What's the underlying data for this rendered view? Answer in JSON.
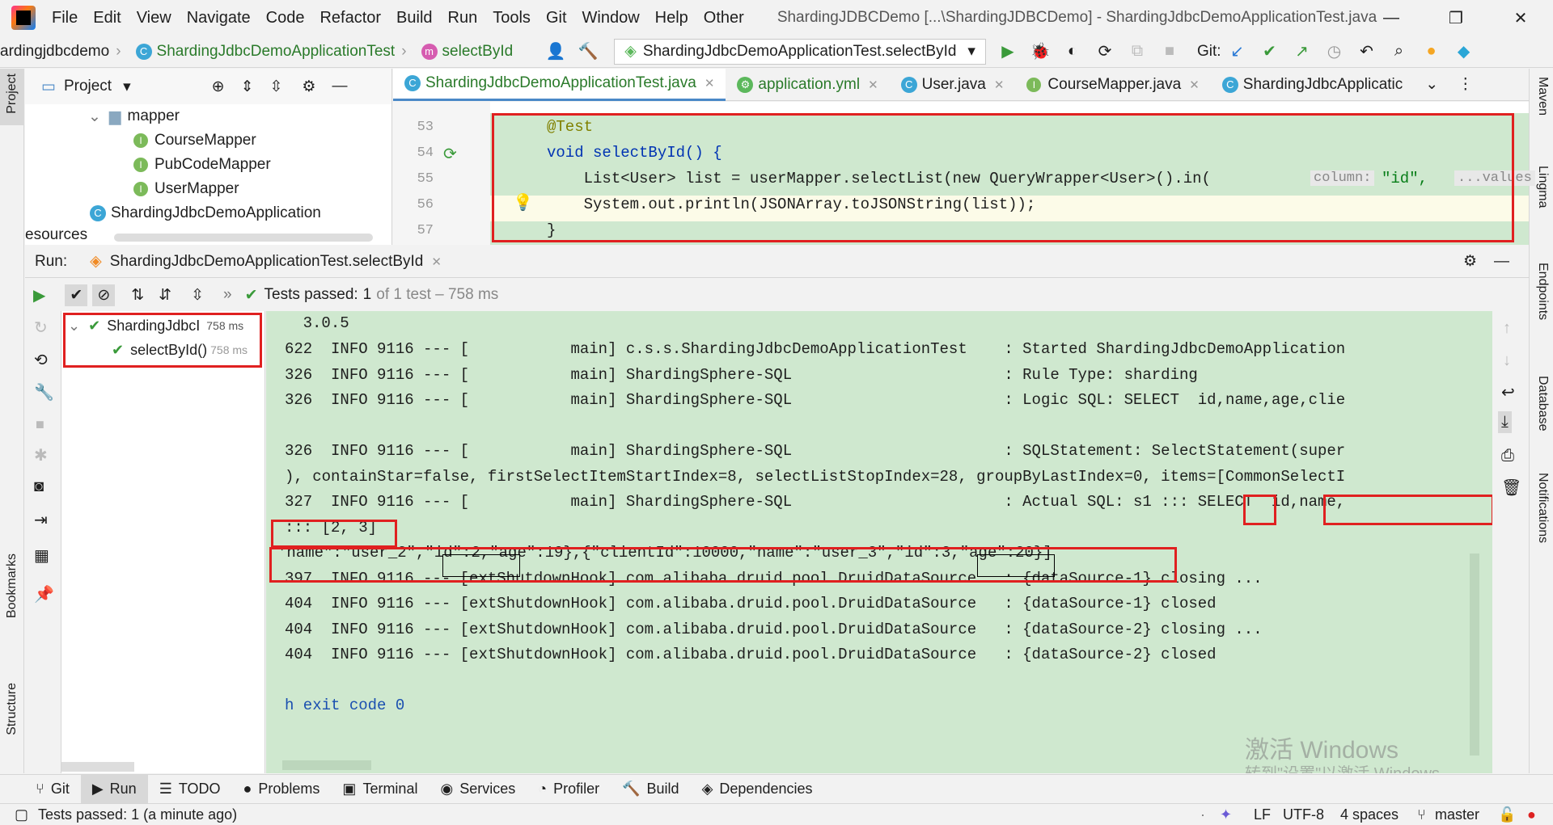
{
  "titlebar": {
    "menu": [
      "File",
      "Edit",
      "View",
      "Navigate",
      "Code",
      "Refactor",
      "Build",
      "Run",
      "Tools",
      "Git",
      "Window",
      "Help",
      "Other"
    ],
    "window_title": "ShardingJDBCDemo [...\\ShardingJDBCDemo] - ShardingJdbcDemoApplicationTest.java"
  },
  "navbar": {
    "project": "ardingjdbcdemo",
    "class": "ShardingJdbcDemoApplicationTest",
    "method": "selectById",
    "run_config": "ShardingJdbcDemoApplicationTest.selectById",
    "git_label": "Git:"
  },
  "project_panel": {
    "title": "Project",
    "items": [
      {
        "label": "mapper",
        "kind": "folder"
      },
      {
        "label": "CourseMapper",
        "kind": "interface"
      },
      {
        "label": "PubCodeMapper",
        "kind": "interface"
      },
      {
        "label": "UserMapper",
        "kind": "interface"
      },
      {
        "label": "ShardingJdbcDemoApplication",
        "kind": "class"
      },
      {
        "label": "esources",
        "kind": "folder"
      }
    ]
  },
  "editor_tabs": [
    {
      "label": "ShardingJdbcDemoApplicationTest.java",
      "active": true
    },
    {
      "label": "application.yml",
      "active": false
    },
    {
      "label": "User.java",
      "active": false
    },
    {
      "label": "CourseMapper.java",
      "active": false
    },
    {
      "label": "ShardingJdbcApplicatic",
      "active": false
    }
  ],
  "editor": {
    "lines": [
      {
        "n": "53",
        "text": "@Test"
      },
      {
        "n": "54",
        "text": "void selectById() {"
      },
      {
        "n": "55",
        "text": "    List<User> list = userMapper.selectList(new QueryWrapper<User>().in("
      },
      {
        "n": "56",
        "text": "    System.out.println(JSONArray.toJSONString(list));"
      },
      {
        "n": "57",
        "text": "}"
      }
    ],
    "hint_column": "column:",
    "hint_id": "\"id\",",
    "hint_values": "...values"
  },
  "run": {
    "label": "Run:",
    "config_tab": "ShardingJdbcDemoApplicationTest.selectById",
    "status": "Tests passed:",
    "status_count": "1",
    "status_rest": "of 1 test – 758 ms",
    "tree": [
      {
        "label": "ShardingJdbcI",
        "time": "758 ms"
      },
      {
        "label": "selectById()",
        "time": "758 ms"
      }
    ]
  },
  "console": {
    "lines": [
      "    3.0.5",
      "622  INFO 9116 --- [           main] c.s.s.ShardingJdbcDemoApplicationTest    : Started ShardingJdbcDemoApplication",
      "326  INFO 9116 --- [           main] ShardingSphere-SQL                       : Rule Type: sharding",
      "326  INFO 9116 --- [           main] ShardingSphere-SQL                       : Logic SQL: SELECT  id,name,age,clie",
      "",
      "326  INFO 9116 --- [           main] ShardingSphere-SQL                       : SQLStatement: SelectStatement(super",
      "), containStar=false, firstSelectItemStartIndex=8, selectListStopIndex=28, groupByLastIndex=0, items=[CommonSelectI",
      "327  INFO 9116 --- [           main] ShardingSphere-SQL                       : Actual SQL: s1 ::: SELECT  id,name,",
      "::: [2, 3]",
      "'name\":\"user_2\",\"id\":2,\"age\":19},{\"clientId\":10000,\"name\":\"user_3\",\"id\":3,\"age\":20}]",
      "397  INFO 9116 --- [extShutdownHook] com.alibaba.druid.pool.DruidDataSource   : {dataSource-1} closing ...",
      "404  INFO 9116 --- [extShutdownHook] com.alibaba.druid.pool.DruidDataSource   : {dataSource-1} closed",
      "404  INFO 9116 --- [extShutdownHook] com.alibaba.druid.pool.DruidDataSource   : {dataSource-2} closing ...",
      "404  INFO 9116 --- [extShutdownHook] com.alibaba.druid.pool.DruidDataSource   : {dataSource-2} closed",
      "",
      "h exit code 0"
    ],
    "watermark_1": "激活 Windows",
    "watermark_2": "转到\"设置\"以激活 Windows。"
  },
  "left_strip": [
    "Project",
    "Bookmarks",
    "Structure"
  ],
  "right_strip": [
    "Maven",
    "Lingma",
    "Endpoints",
    "Database",
    "Notifications"
  ],
  "bottom_tabs": [
    "Git",
    "Run",
    "TODO",
    "Problems",
    "Terminal",
    "Services",
    "Profiler",
    "Build",
    "Dependencies"
  ],
  "statusbar": {
    "message": "Tests passed: 1 (a minute ago)",
    "line_sep": "LF",
    "encoding": "UTF-8",
    "indent": "4 spaces",
    "branch": "master"
  }
}
